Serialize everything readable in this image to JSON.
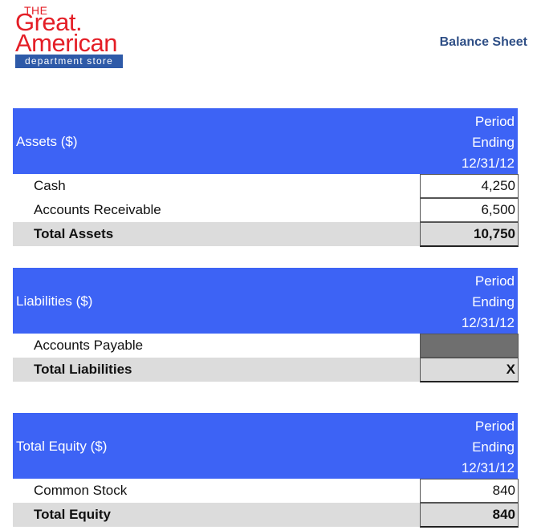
{
  "logo": {
    "the": "THE",
    "great": "Great.",
    "american": "American",
    "department": "department store"
  },
  "sheet_title": "Balance Sheet",
  "period_header": [
    "Period",
    "Ending",
    "12/31/12"
  ],
  "assets": {
    "title": "Assets ($)",
    "rows": [
      {
        "label": "Cash",
        "value": "4,250"
      },
      {
        "label": "Accounts Receivable",
        "value": "6,500"
      }
    ],
    "total": {
      "label": "Total Assets",
      "value": "10,750"
    }
  },
  "liabilities": {
    "title": "Liabilities ($)",
    "rows": [
      {
        "label": "Accounts Payable",
        "value": ""
      }
    ],
    "total": {
      "label": "Total Liabilities",
      "value": "X"
    }
  },
  "equity": {
    "title": "Total Equity ($)",
    "rows": [
      {
        "label": "Common Stock",
        "value": "840"
      }
    ],
    "total": {
      "label": "Total Equity",
      "value": "840"
    }
  },
  "colors": {
    "header_blue": "#3d63f5",
    "logo_red": "#e41e26",
    "logo_blue": "#2e5aa8",
    "total_gray": "#dcdcdc",
    "input_gray": "#6f6f6f"
  }
}
